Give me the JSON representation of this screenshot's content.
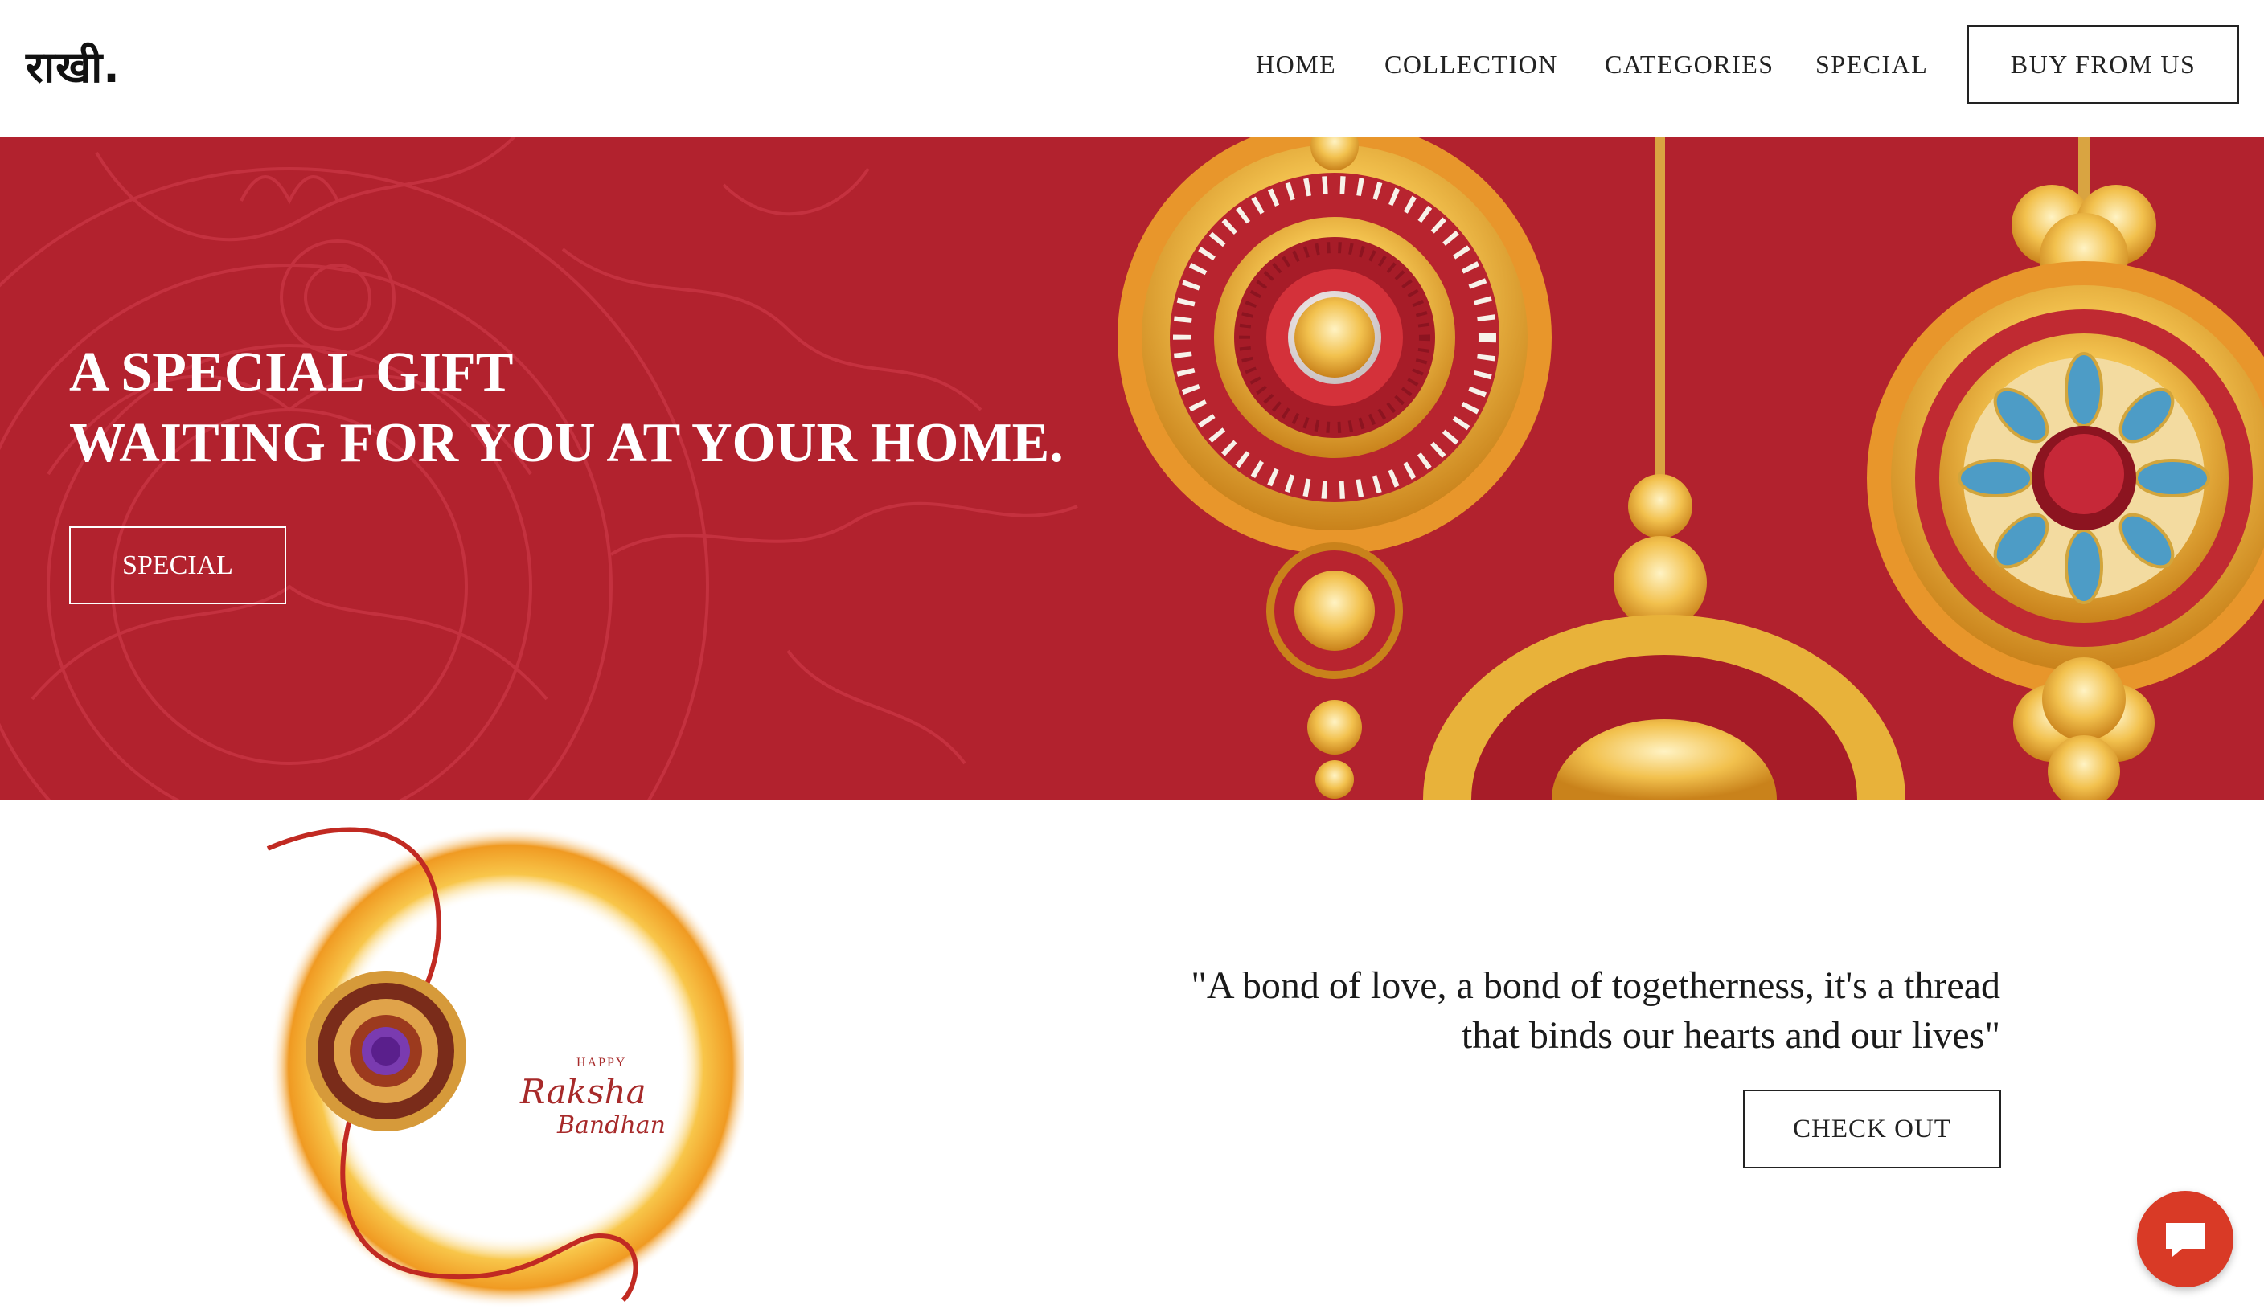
{
  "header": {
    "logo": "राखी.",
    "nav": [
      "HOME",
      "COLLECTION",
      "CATEGORIES",
      "SPECIAL"
    ],
    "cta_label": "BUY FROM US"
  },
  "hero": {
    "title_line1": "A SPECIAL GIFT",
    "title_line2": "WAITING FOR YOU AT YOUR HOME.",
    "button_label": "SPECIAL",
    "background_color": "#b2222e"
  },
  "promo": {
    "card_small": "HAPPY",
    "card_title": "Raksha",
    "card_subtitle": "Bandhan",
    "quote_line1": "\"A bond of love, a bond of togetherness, it's a thread",
    "quote_line2": "that binds our hearts and our lives\"",
    "button_label": "CHECK OUT"
  },
  "chat": {
    "icon": "chat-bubble-icon",
    "color": "#d93a26"
  }
}
